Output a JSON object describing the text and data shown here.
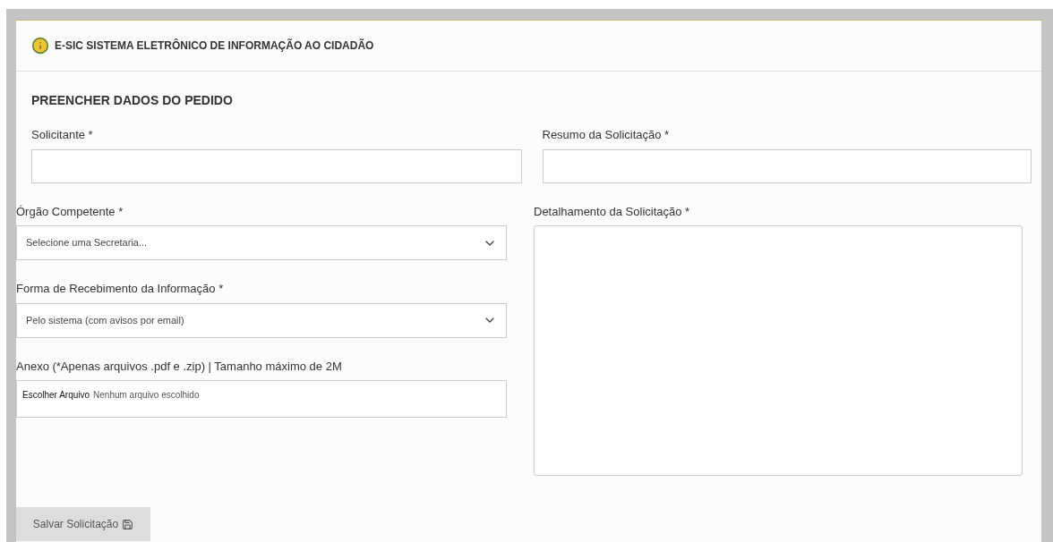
{
  "header": {
    "title": "E-SIC SISTEMA ELETRÔNICO DE INFORMAÇÃO AO CIDADÃO"
  },
  "form": {
    "title": "PREENCHER DADOS DO PEDIDO",
    "requester": {
      "label": "Solicitante *"
    },
    "summary": {
      "label": "Resumo da Solicitação *"
    },
    "agency": {
      "label": "Órgão Competente *",
      "value": "Selecione uma Secretaria..."
    },
    "delivery": {
      "label": "Forma de Recebimento da Informação *",
      "value": "Pelo sistema (com avisos por email)"
    },
    "attachment": {
      "label": "Anexo (*Apenas arquivos .pdf e .zip) | Tamanho máximo de 2M",
      "button": "Escolher Arquivo",
      "status": "Nenhum arquivo escolhido"
    },
    "details": {
      "label": "Detalhamento da Solicitação *"
    },
    "save_button": "Salvar Solicitação"
  }
}
